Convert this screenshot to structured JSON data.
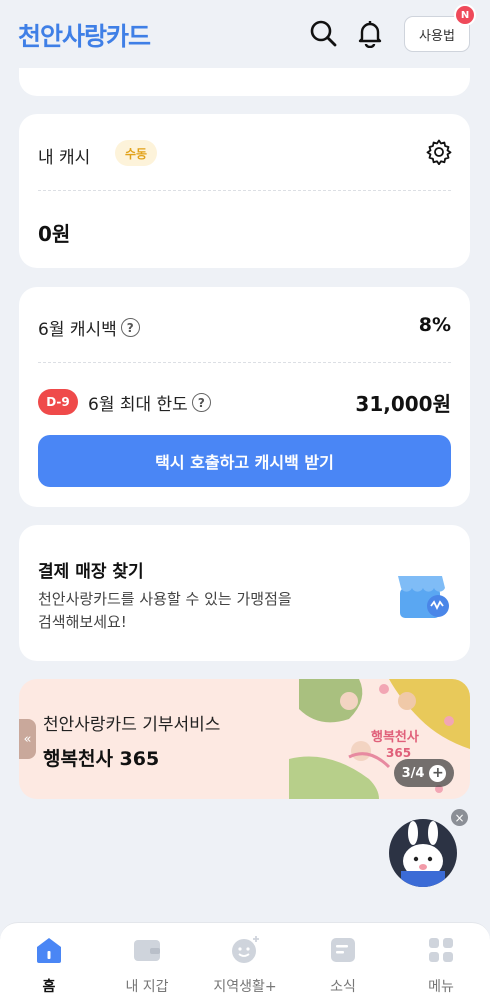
{
  "header": {
    "app_title": "천안사랑카드",
    "guide_label": "사용법",
    "new_badge": "N"
  },
  "cash": {
    "label": "내 캐시",
    "mode_badge": "수동",
    "amount": "0원"
  },
  "cashback": {
    "rate_label": "6월 캐시백",
    "rate_value": "8%",
    "dday": "D-9",
    "limit_label": "6월 최대 한도",
    "limit_value": "31,000원",
    "help_glyph": "?",
    "taxi_button": "택시 호출하고 캐시백 받기"
  },
  "store": {
    "title": "결제 매장 찾기",
    "desc_line1": "천안사랑카드를 사용할 수 있는 가맹점을",
    "desc_line2": "검색해보세요!"
  },
  "banner": {
    "subtitle": "천안사랑카드 기부서비스",
    "title": "행복천사 365",
    "art_text_1": "행복천사",
    "art_text_2": "365",
    "pager": "3/4",
    "pager_plus": "+",
    "prev_glyph": "«"
  },
  "chatbot": {
    "close_glyph": "×"
  },
  "nav": {
    "items": [
      {
        "label": "홈"
      },
      {
        "label": "내 지갑"
      },
      {
        "label": "지역생활+"
      },
      {
        "label": "소식"
      },
      {
        "label": "메뉴"
      }
    ]
  },
  "colors": {
    "brand": "#3f7fe6",
    "primary_button": "#4a86f5",
    "dday_red": "#ef4a4a",
    "badge_yellow": "#e1a21a",
    "background": "#eef1f6",
    "banner_bg": "#fde9e2"
  }
}
